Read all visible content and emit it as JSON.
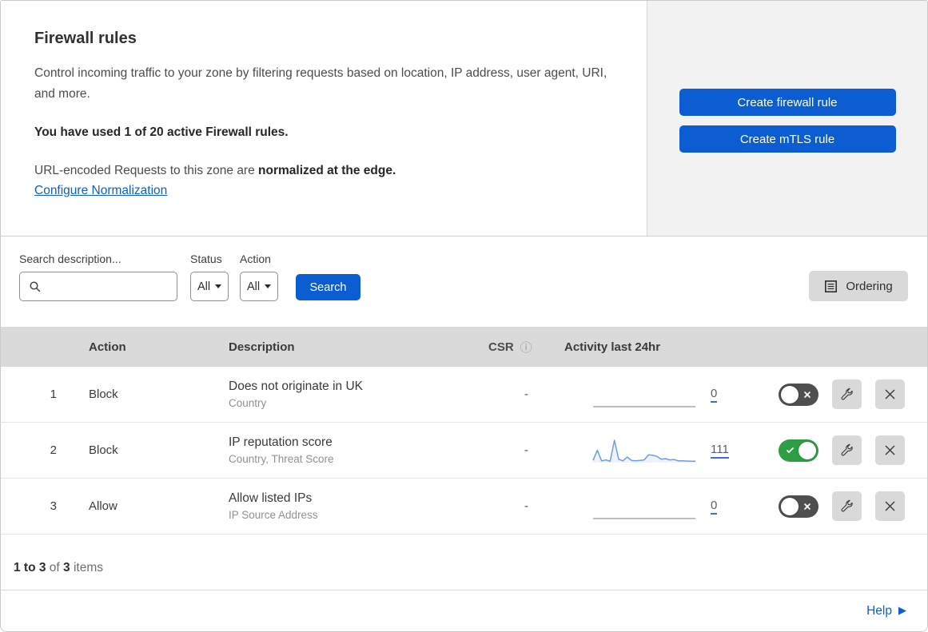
{
  "header": {
    "title": "Firewall rules",
    "description": "Control incoming traffic to your zone by filtering requests based on location, IP address, user agent, URI, and more.",
    "usage": "You have used 1 of 20 active Firewall rules.",
    "normalization_text": "URL-encoded Requests to this zone are ",
    "normalization_bold": "normalized at the edge.",
    "normalization_link": "Configure Normalization",
    "buttons": {
      "create_firewall": "Create firewall rule",
      "create_mtls": "Create mTLS rule"
    }
  },
  "filters": {
    "search_label": "Search description...",
    "search_value": "",
    "status_label": "Status",
    "status_value": "All",
    "action_label": "Action",
    "action_value": "All",
    "search_button": "Search",
    "ordering_button": "Ordering"
  },
  "table": {
    "columns": {
      "action": "Action",
      "description": "Description",
      "csr": "CSR",
      "activity": "Activity last 24hr"
    },
    "rows": [
      {
        "priority": "1",
        "action": "Block",
        "description": "Does not originate in UK",
        "criteria": "Country",
        "csr": "-",
        "activity_count": "0",
        "enabled": false,
        "sparkline": [
          0,
          0
        ]
      },
      {
        "priority": "2",
        "action": "Block",
        "description": "IP reputation score",
        "criteria": "Country, Threat Score",
        "csr": "-",
        "activity_count": "111",
        "enabled": true,
        "sparkline": [
          10,
          55,
          8,
          12,
          6,
          100,
          15,
          8,
          25,
          10,
          8,
          10,
          12,
          35,
          33,
          28,
          15,
          18,
          12,
          14,
          8,
          8,
          7,
          6,
          6
        ]
      },
      {
        "priority": "3",
        "action": "Allow",
        "description": "Allow listed IPs",
        "criteria": "IP Source Address",
        "csr": "-",
        "activity_count": "0",
        "enabled": false,
        "sparkline": [
          0,
          0
        ]
      }
    ]
  },
  "footer": {
    "range": "1 to 3",
    "of": "of",
    "total": "3",
    "items": "items",
    "help": "Help"
  },
  "icons": {
    "info_glyph": "ⓘ",
    "help_arrow_glyph": "▶"
  },
  "colors": {
    "accent_blue": "#0c5dd2",
    "toggle_on_green": "#2e9e44",
    "toggle_off_gray": "#4f4f4f",
    "table_header_gray": "#dadada",
    "panel_gray": "#f2f2f2",
    "sparkline_stroke": "#6f9ee0",
    "sparkline_fill": "rgba(90,140,220,0.10)",
    "flat_line_gray": "#a9a9a9"
  }
}
